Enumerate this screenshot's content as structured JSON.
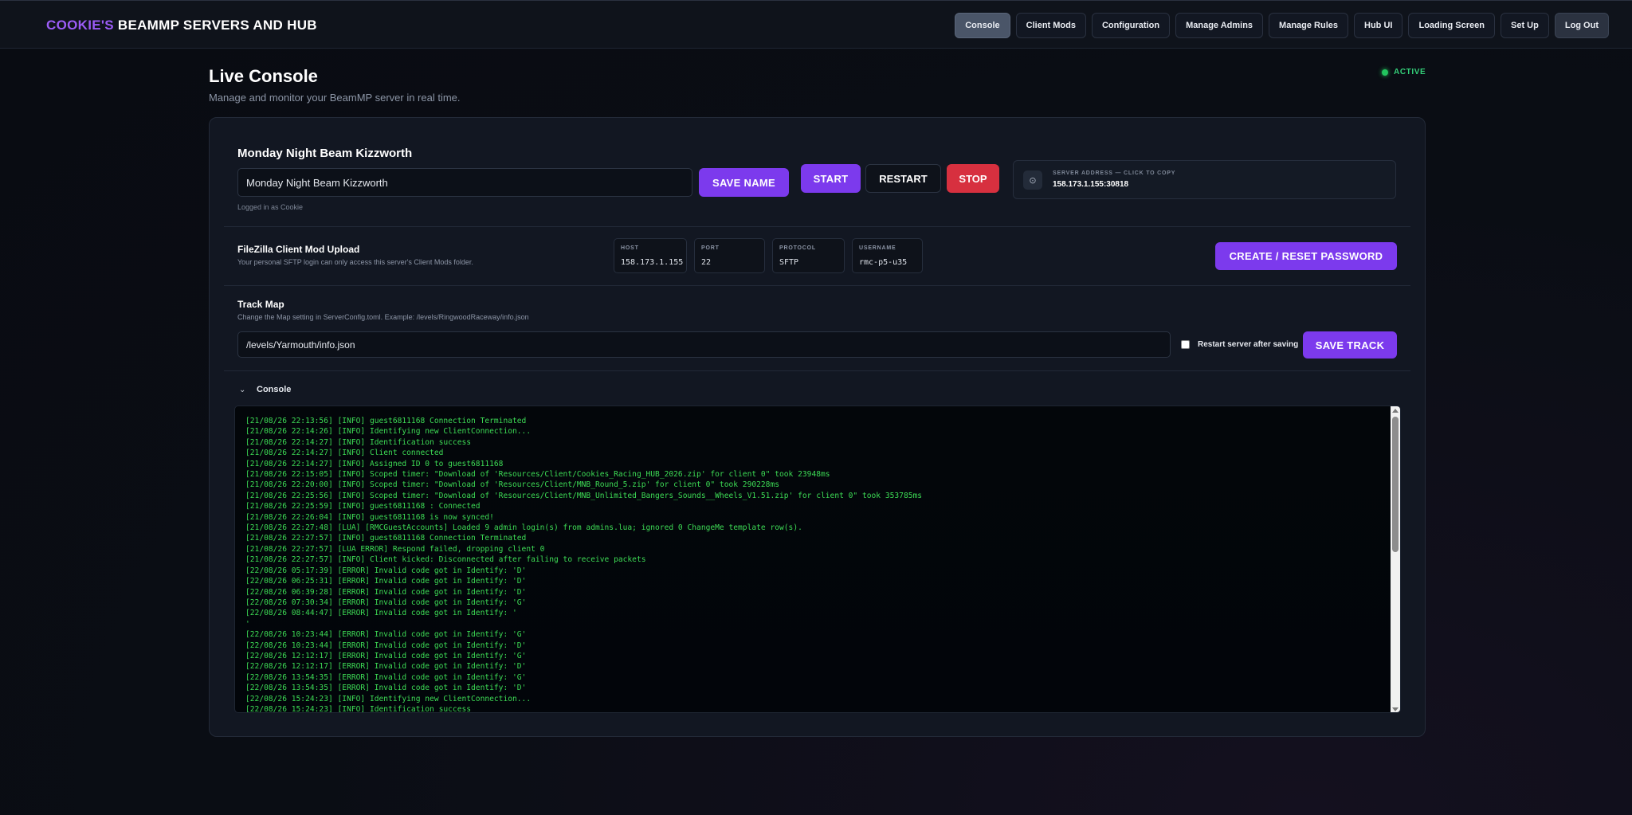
{
  "brand": {
    "accent": "COOKIE'S",
    "rest": " BEAMMP SERVERS AND HUB"
  },
  "nav": [
    {
      "label": "Console",
      "active": true
    },
    {
      "label": "Client Mods"
    },
    {
      "label": "Configuration"
    },
    {
      "label": "Manage Admins"
    },
    {
      "label": "Manage Rules"
    },
    {
      "label": "Hub UI"
    },
    {
      "label": "Loading Screen"
    },
    {
      "label": "Set Up"
    },
    {
      "label": "Log Out"
    }
  ],
  "page": {
    "title": "Live Console",
    "subtitle": "Manage and monitor your BeamMP server in real time.",
    "status": "ACTIVE"
  },
  "server": {
    "name_label": "Monday Night Beam Kizzworth",
    "name_value": "Monday Night Beam Kizzworth",
    "save_name": "SAVE NAME",
    "start": "START",
    "restart": "RESTART",
    "stop": "STOP",
    "logged_in": "Logged in as Cookie",
    "address_label": "SERVER ADDRESS — CLICK TO COPY",
    "address_value": "158.173.1.155:30818"
  },
  "filezilla": {
    "title": "FileZilla Client Mod Upload",
    "subtitle": "Your personal SFTP login can only access this server's Client Mods folder.",
    "host_label": "HOST",
    "host_value": "158.173.1.155",
    "port_label": "PORT",
    "port_value": "22",
    "protocol_label": "PROTOCOL",
    "protocol_value": "SFTP",
    "username_label": "USERNAME",
    "username_value": "rmc-p5-u35",
    "create_button": "CREATE / RESET PASSWORD"
  },
  "track": {
    "title": "Track Map",
    "subtitle": "Change the Map setting in ServerConfig.toml. Example: /levels/RingwoodRaceway/info.json",
    "value": "/levels/Yarmouth/info.json",
    "restart_label": "Restart server after saving",
    "save_button": "SAVE TRACK"
  },
  "console": {
    "title": "Console",
    "lines": [
      "[21/08/26 22:13:56] [INFO] guest6811168 Connection Terminated",
      "[21/08/26 22:14:26] [INFO] Identifying new ClientConnection...",
      "[21/08/26 22:14:27] [INFO] Identification success",
      "[21/08/26 22:14:27] [INFO] Client connected",
      "[21/08/26 22:14:27] [INFO] Assigned ID 0 to guest6811168",
      "[21/08/26 22:15:05] [INFO] Scoped timer: \"Download of 'Resources/Client/Cookies_Racing_HUB_2026.zip' for client 0\" took 23948ms",
      "[21/08/26 22:20:00] [INFO] Scoped timer: \"Download of 'Resources/Client/MNB_Round_5.zip' for client 0\" took 290228ms",
      "[21/08/26 22:25:56] [INFO] Scoped timer: \"Download of 'Resources/Client/MNB_Unlimited_Bangers_Sounds__Wheels_V1.51.zip' for client 0\" took 353785ms",
      "[21/08/26 22:25:59] [INFO] guest6811168 : Connected",
      "[21/08/26 22:26:04] [INFO] guest6811168 is now synced!",
      "[21/08/26 22:27:48] [LUA] [RMCGuestAccounts] Loaded 9 admin login(s) from admins.lua; ignored 0 ChangeMe template row(s).",
      "[21/08/26 22:27:57] [INFO] guest6811168 Connection Terminated",
      "[21/08/26 22:27:57] [LUA ERROR] Respond failed, dropping client 0",
      "[21/08/26 22:27:57] [INFO] Client kicked: Disconnected after failing to receive packets",
      "[22/08/26 05:17:39] [ERROR] Invalid code got in Identify: 'D'",
      "[22/08/26 06:25:31] [ERROR] Invalid code got in Identify: 'D'",
      "[22/08/26 06:39:28] [ERROR] Invalid code got in Identify: 'D'",
      "[22/08/26 07:30:34] [ERROR] Invalid code got in Identify: 'G'",
      "[22/08/26 08:44:47] [ERROR] Invalid code got in Identify: '",
      "'",
      "[22/08/26 10:23:44] [ERROR] Invalid code got in Identify: 'G'",
      "[22/08/26 10:23:44] [ERROR] Invalid code got in Identify: 'D'",
      "[22/08/26 12:12:17] [ERROR] Invalid code got in Identify: 'G'",
      "[22/08/26 12:12:17] [ERROR] Invalid code got in Identify: 'D'",
      "[22/08/26 13:54:35] [ERROR] Invalid code got in Identify: 'G'",
      "[22/08/26 13:54:35] [ERROR] Invalid code got in Identify: 'D'",
      "[22/08/26 15:24:23] [INFO] Identifying new ClientConnection...",
      "[22/08/26 15:24:23] [INFO] Identification success"
    ]
  }
}
